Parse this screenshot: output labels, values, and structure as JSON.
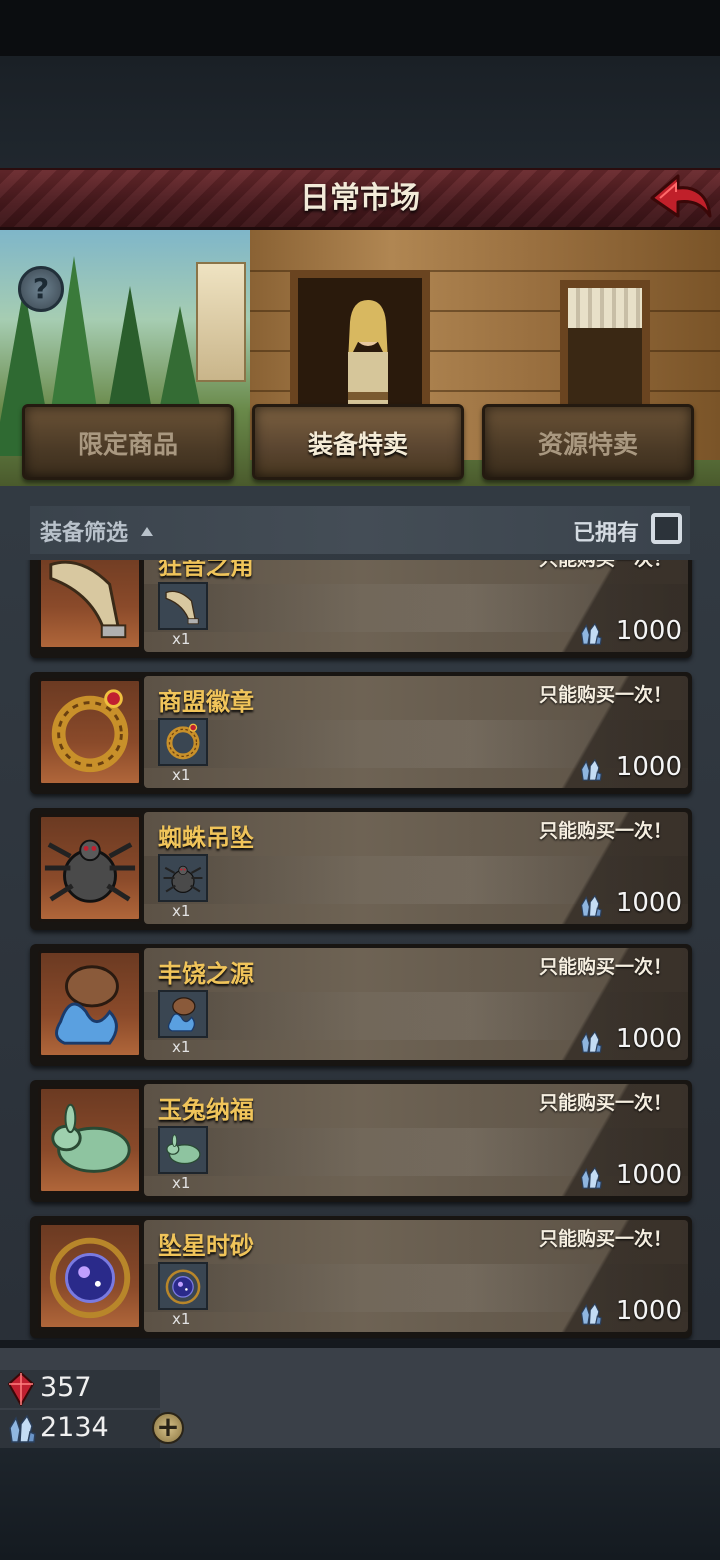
{
  "header": {
    "title": "日常市场"
  },
  "tabs": [
    {
      "label": "限定商品",
      "active": false
    },
    {
      "label": "装备特卖",
      "active": true
    },
    {
      "label": "资源特卖",
      "active": false
    }
  ],
  "filter": {
    "label": "装备筛选",
    "owned_label": "已拥有",
    "owned_checked": false
  },
  "items": [
    {
      "name": "狂音之角",
      "limit": "只能购买一次！",
      "qty": "x1",
      "price": "1000",
      "icon": "horn-icon"
    },
    {
      "name": "商盟徽章",
      "limit": "只能购买一次！",
      "qty": "x1",
      "price": "1000",
      "icon": "golden-serpent-badge-icon"
    },
    {
      "name": "蜘蛛吊坠",
      "limit": "只能购买一次！",
      "qty": "x1",
      "price": "1000",
      "icon": "spider-pendant-icon"
    },
    {
      "name": "丰饶之源",
      "limit": "只能购买一次！",
      "qty": "x1",
      "price": "1000",
      "icon": "water-jug-icon"
    },
    {
      "name": "玉兔纳福",
      "limit": "只能购买一次！",
      "qty": "x1",
      "price": "1000",
      "icon": "jade-rabbit-icon"
    },
    {
      "name": "坠星时砂",
      "limit": "只能购买一次！",
      "qty": "x1",
      "price": "1000",
      "icon": "star-orb-icon"
    }
  ],
  "currency": {
    "red_gem": "357",
    "blue_crystal": "2134"
  },
  "colors": {
    "title_bar": "#4a1a1e",
    "item_name": "#f0c45a",
    "card_body": "#6e6354"
  }
}
